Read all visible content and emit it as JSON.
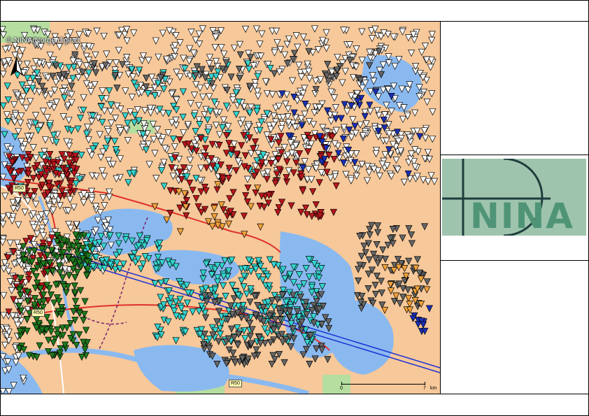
{
  "layout": {
    "title": "",
    "footer": "",
    "side_panel_top": "",
    "side_panel_bottom": ""
  },
  "map": {
    "credit": "© NINA/Norge digitalt",
    "road_labels": [
      "R50",
      "R50",
      "R50"
    ],
    "scale": {
      "start": "0",
      "end": "7",
      "unit": "km"
    },
    "colors": {
      "land": "#f6c89a",
      "water": "#8ab9f0",
      "forest": "#b5dea0",
      "river": "#8ab9f0",
      "road_red": "#e0302a",
      "powerline": "#1a2fd6",
      "boundary": "#7a1d6a",
      "symbol_white": "#ffffff",
      "symbol_cyan": "#33d6d0",
      "symbol_red": "#b8161c",
      "symbol_grey": "#666666",
      "symbol_green": "#1e7a1e",
      "symbol_orange": "#f2a23a",
      "symbol_blue": "#1a2fb8"
    },
    "symbol_type": "downward-triangle"
  },
  "logo": {
    "text": "NINA",
    "background": "#9ec4ad",
    "text_color": "#4f9477"
  },
  "icons": {
    "north_arrow": "north-arrow-icon"
  }
}
